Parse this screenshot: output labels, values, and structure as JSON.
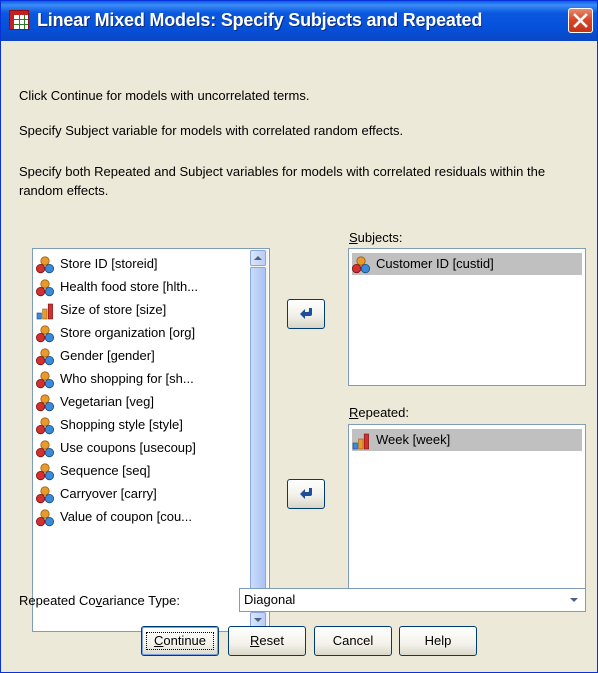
{
  "window": {
    "title": "Linear Mixed Models: Specify Subjects and Repeated",
    "title_icon": "spss-dialog-icon",
    "close_icon": "close-icon"
  },
  "instructions": {
    "line1": "Click Continue for models with uncorrelated terms.",
    "line2": "Specify Subject variable for models with correlated random effects.",
    "line3": "Specify both Repeated and Subject variables for models with correlated residuals within the random effects."
  },
  "variables": {
    "items": [
      {
        "label": "Store ID [storeid]",
        "icon": "nominal-icon"
      },
      {
        "label": "Health food store [hlth...",
        "icon": "nominal-icon"
      },
      {
        "label": "Size of store [size]",
        "icon": "ordinal-icon"
      },
      {
        "label": "Store organization [org]",
        "icon": "nominal-icon"
      },
      {
        "label": "Gender [gender]",
        "icon": "nominal-icon"
      },
      {
        "label": "Who shopping for [sh...",
        "icon": "nominal-icon"
      },
      {
        "label": "Vegetarian [veg]",
        "icon": "nominal-icon"
      },
      {
        "label": "Shopping style [style]",
        "icon": "nominal-icon"
      },
      {
        "label": "Use coupons [usecoup]",
        "icon": "nominal-icon"
      },
      {
        "label": "Sequence [seq]",
        "icon": "nominal-icon"
      },
      {
        "label": "Carryover [carry]",
        "icon": "nominal-icon"
      },
      {
        "label": "Value of coupon [cou...",
        "icon": "nominal-icon"
      }
    ]
  },
  "subjects": {
    "label_prefix": "",
    "label_mnemonic": "S",
    "label_rest": "ubjects:",
    "items": [
      {
        "label": "Customer ID [custid]",
        "icon": "nominal-icon",
        "selected": true
      }
    ]
  },
  "repeated": {
    "label_mnemonic": "R",
    "label_rest": "epeated:",
    "items": [
      {
        "label": "Week [week]",
        "icon": "ordinal-icon",
        "selected": true
      }
    ]
  },
  "covariance": {
    "label_before": "Repeated Co",
    "label_mnemonic": "v",
    "label_after": "ariance Type:",
    "selected_value": "Diagonal"
  },
  "buttons": {
    "continue": {
      "mnemonic": "C",
      "rest": "ontinue"
    },
    "reset": {
      "mnemonic": "R",
      "rest": "eset"
    },
    "cancel": {
      "label": "Cancel"
    },
    "help": {
      "label": "Help"
    }
  },
  "colors": {
    "titlebar": "#0550d9",
    "dialog_bg": "#ece9d8",
    "selection": "#c0c0c0",
    "list_border": "#7f9db9"
  }
}
